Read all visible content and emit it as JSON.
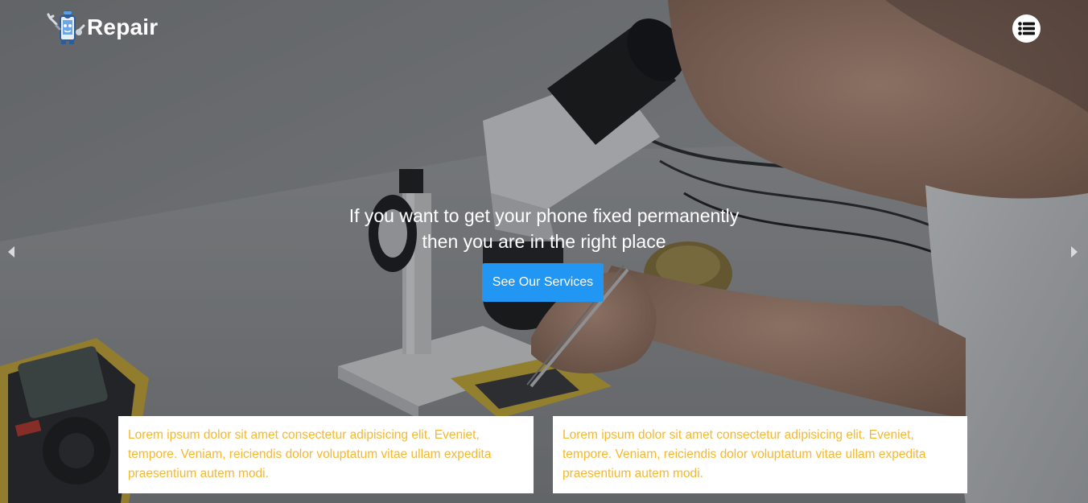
{
  "brand": {
    "logo_icon": "mascot-phone-icon",
    "name": "Repair"
  },
  "nav": {
    "menu_icon": "list-icon"
  },
  "carousel": {
    "prev_icon": "caret-left-icon",
    "next_icon": "caret-right-icon",
    "headline_line1": "If you want to get your phone fixed permanently",
    "headline_line2": "then you are in the right place",
    "cta_label": "See Our Services"
  },
  "cards": [
    {
      "text": "Lorem ipsum dolor sit amet consectetur adipisicing elit. Eveniet, tempore. Veniam, reiciendis dolor voluptatum vitae ullam expedita praesentium autem modi."
    },
    {
      "text": "Lorem ipsum dolor sit amet consectetur adipisicing elit. Eveniet, tempore. Veniam, reiciendis dolor voluptatum vitae ullam expedita praesentium autem modi."
    }
  ],
  "colors": {
    "accent": "#2196f3",
    "card_text": "#f5b82e",
    "card_bg": "#ffffff",
    "overlay": "#141619"
  }
}
